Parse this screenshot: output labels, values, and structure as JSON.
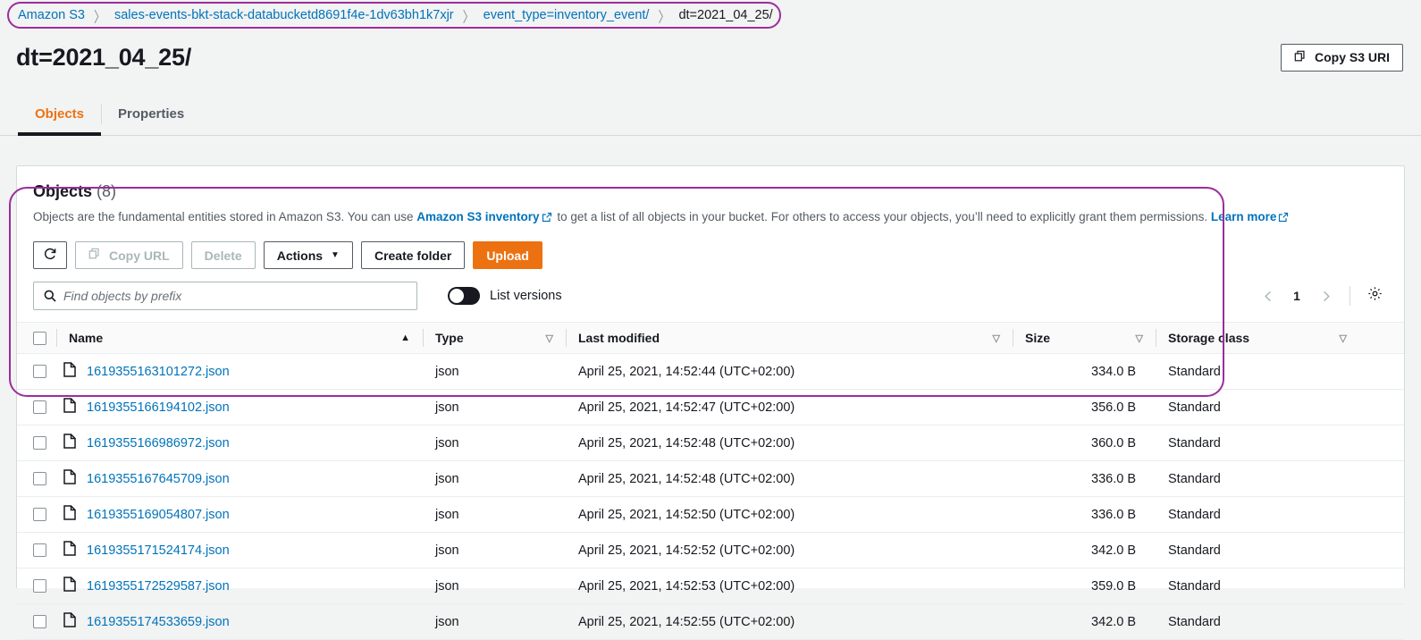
{
  "breadcrumb": {
    "name": "s3-breadcrumb",
    "separator": "〉",
    "items": [
      {
        "label": "Amazon S3",
        "current": false
      },
      {
        "label": "sales-events-bkt-stack-databucketd8691f4e-1dv63bh1k7xjr",
        "current": false
      },
      {
        "label": "event_type=inventory_event/",
        "current": false
      },
      {
        "label": "dt=2021_04_25/",
        "current": true
      }
    ]
  },
  "header": {
    "title": "dt=2021_04_25/",
    "copy_uri_label": "Copy S3 URI",
    "copy_uri_icon": "copy-icon"
  },
  "tabs": [
    {
      "label": "Objects",
      "active": true
    },
    {
      "label": "Properties",
      "active": false
    }
  ],
  "objects_panel": {
    "title": "Objects",
    "count": "(8)",
    "description_part1": "Objects are the fundamental entities stored in Amazon S3. You can use ",
    "inventory_link": "Amazon S3 inventory",
    "description_part2": " to get a list of all objects in your bucket. For others to access your objects, you’ll need to explicitly grant them permissions. ",
    "learn_more_link": "Learn more",
    "toolbar": {
      "refresh_icon": "refresh-icon",
      "copy_url_label": "Copy URL",
      "copy_url_icon": "copy-icon",
      "copy_url_disabled": true,
      "delete_label": "Delete",
      "delete_disabled": true,
      "actions_label": "Actions",
      "actions_caret": "▼",
      "create_folder_label": "Create folder",
      "upload_label": "Upload"
    },
    "filter": {
      "search_placeholder": "Find objects by prefix",
      "search_value": "",
      "search_icon": "search-icon",
      "list_versions_label": "List versions",
      "list_versions_on": false
    },
    "pagination": {
      "prev_icon": "chevron-left-icon",
      "page": "1",
      "next_icon": "chevron-right-icon",
      "settings_icon": "gear-icon"
    },
    "table": {
      "columns": [
        {
          "label": "Name",
          "sort": "asc",
          "sort_glyph": "▲"
        },
        {
          "label": "Type",
          "sort": "none",
          "sort_glyph": "▽"
        },
        {
          "label": "Last modified",
          "sort": "none",
          "sort_glyph": "▽"
        },
        {
          "label": "Size",
          "sort": "none",
          "sort_glyph": "▽"
        },
        {
          "label": "Storage class",
          "sort": "none",
          "sort_glyph": "▽"
        }
      ],
      "rows": [
        {
          "name": "1619355163101272.json",
          "type": "json",
          "last_modified": "April 25, 2021, 14:52:44 (UTC+02:00)",
          "size": "334.0 B",
          "storage_class": "Standard",
          "icon": "file-icon",
          "checked": false
        },
        {
          "name": "1619355166194102.json",
          "type": "json",
          "last_modified": "April 25, 2021, 14:52:47 (UTC+02:00)",
          "size": "356.0 B",
          "storage_class": "Standard",
          "icon": "file-icon",
          "checked": false
        },
        {
          "name": "1619355166986972.json",
          "type": "json",
          "last_modified": "April 25, 2021, 14:52:48 (UTC+02:00)",
          "size": "360.0 B",
          "storage_class": "Standard",
          "icon": "file-icon",
          "checked": false
        },
        {
          "name": "1619355167645709.json",
          "type": "json",
          "last_modified": "April 25, 2021, 14:52:48 (UTC+02:00)",
          "size": "336.0 B",
          "storage_class": "Standard",
          "icon": "file-icon",
          "checked": false
        },
        {
          "name": "1619355169054807.json",
          "type": "json",
          "last_modified": "April 25, 2021, 14:52:50 (UTC+02:00)",
          "size": "336.0 B",
          "storage_class": "Standard",
          "icon": "file-icon",
          "checked": false
        },
        {
          "name": "1619355171524174.json",
          "type": "json",
          "last_modified": "April 25, 2021, 14:52:52 (UTC+02:00)",
          "size": "342.0 B",
          "storage_class": "Standard",
          "icon": "file-icon",
          "checked": false
        },
        {
          "name": "1619355172529587.json",
          "type": "json",
          "last_modified": "April 25, 2021, 14:52:53 (UTC+02:00)",
          "size": "359.0 B",
          "storage_class": "Standard",
          "icon": "file-icon",
          "checked": false
        },
        {
          "name": "1619355174533659.json",
          "type": "json",
          "last_modified": "April 25, 2021, 14:52:55 (UTC+02:00)",
          "size": "342.0 B",
          "storage_class": "Standard",
          "icon": "file-icon",
          "checked": false
        }
      ]
    }
  },
  "colors": {
    "accent_orange": "#ec7211",
    "link_blue": "#0073bb",
    "annotation_purple": "#9b2d9b",
    "page_bg": "#f2f3f3",
    "text_dark": "#16191f"
  }
}
